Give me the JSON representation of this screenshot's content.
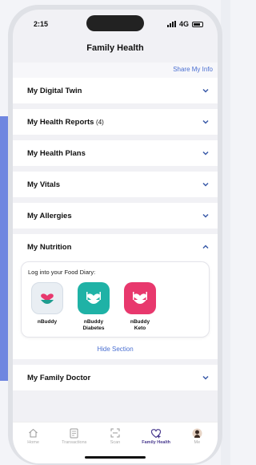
{
  "status": {
    "time": "2:15",
    "network": "4G"
  },
  "header": {
    "title": "Family Health"
  },
  "share_link": "Share My Info",
  "sections": [
    {
      "label": "My Digital Twin",
      "count": ""
    },
    {
      "label": "My Health Reports",
      "count": "(4)"
    },
    {
      "label": "My Health Plans",
      "count": ""
    },
    {
      "label": "My Vitals",
      "count": ""
    },
    {
      "label": "My Allergies",
      "count": ""
    }
  ],
  "nutrition": {
    "label": "My Nutrition",
    "diary_label": "Log into your Food Diary:",
    "apps": [
      {
        "name_line1": "nBuddy",
        "name_line2": "",
        "color": "#e9eef3",
        "accent": "#e8386d"
      },
      {
        "name_line1": "nBuddy",
        "name_line2": "Diabetes",
        "color": "#1fb2a6",
        "accent": "#ffffff"
      },
      {
        "name_line1": "nBuddy",
        "name_line2": "Keto",
        "color": "#e8386d",
        "accent": "#ffffff"
      }
    ],
    "hide_label": "Hide Section"
  },
  "family_doctor": {
    "label": "My Family Doctor"
  },
  "tabs": [
    {
      "label": "Home",
      "icon": "home-icon"
    },
    {
      "label": "Transactions",
      "icon": "receipt-icon"
    },
    {
      "label": "Scan",
      "icon": "scan-icon"
    },
    {
      "label": "Family Health",
      "icon": "heart-plus-icon",
      "active": true
    },
    {
      "label": "Me",
      "icon": "avatar-icon"
    }
  ],
  "colors": {
    "link": "#4a6fd1",
    "accent_pink": "#e8386d",
    "accent_teal": "#1fb2a6"
  }
}
